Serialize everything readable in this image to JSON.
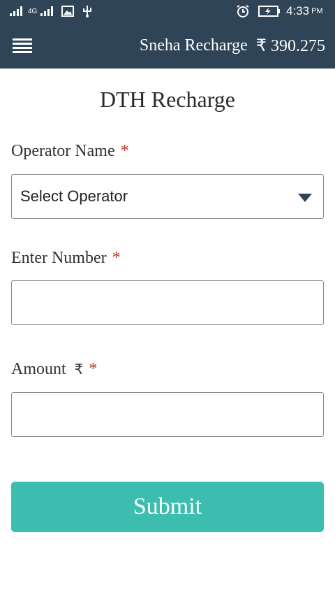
{
  "status_bar": {
    "network_type": "4G",
    "time": "4:33",
    "meridiem": "PM",
    "icons": [
      "signal-icon",
      "signal-icon",
      "gallery-icon",
      "usb-icon",
      "alarm-icon",
      "battery-charging-icon"
    ]
  },
  "app_bar": {
    "menu_icon": "hamburger-menu-icon",
    "title": "Sneha Recharge",
    "balance": "₹ 390.275"
  },
  "page": {
    "title": "DTH Recharge"
  },
  "form": {
    "operator_label": "Operator Name",
    "operator_selected": "Select Operator",
    "number_label": "Enter Number",
    "number_value": "",
    "amount_label": "Amount",
    "currency_symbol": "₹",
    "amount_value": "",
    "required_marker": "*",
    "submit_label": "Submit"
  },
  "colors": {
    "header_bg": "#2f4457",
    "accent": "#3dbdb0",
    "required": "#c0392b"
  }
}
